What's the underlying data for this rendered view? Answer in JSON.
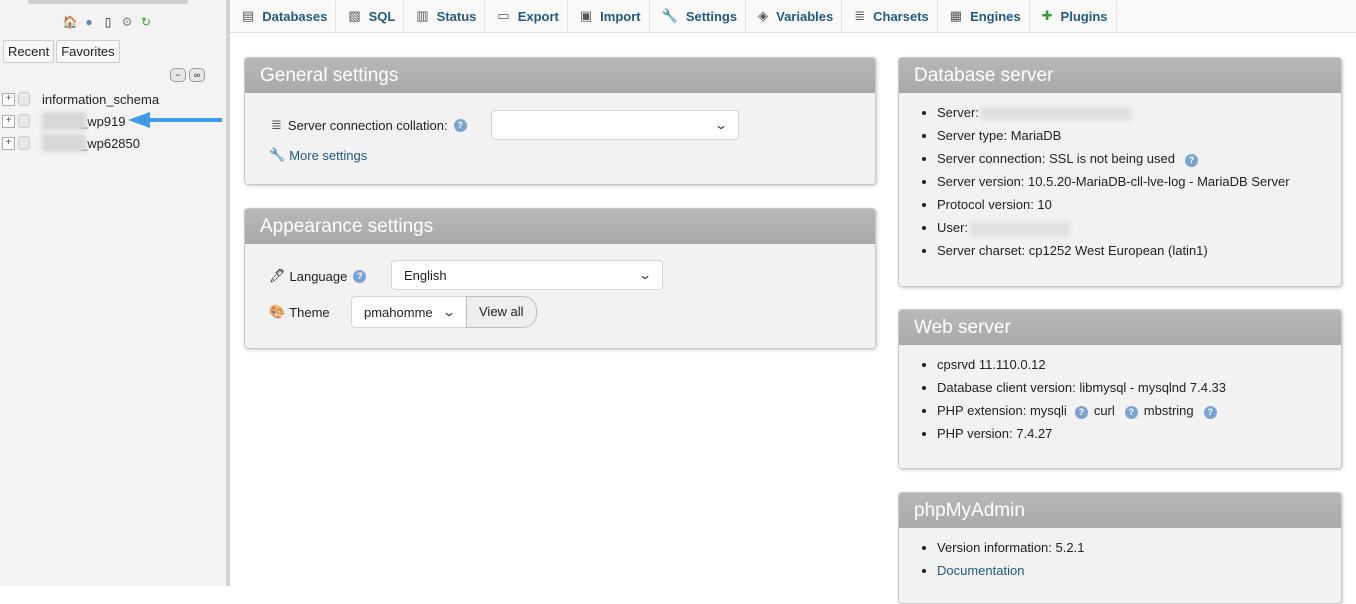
{
  "nav": {
    "tabs": [
      "Recent",
      "Favorites"
    ],
    "databases": [
      {
        "name": "information_schema"
      },
      {
        "name": "_wp919"
      },
      {
        "name": "_wp62850"
      }
    ],
    "icons": [
      "home-icon",
      "help-icon",
      "docs-icon",
      "gear-icon",
      "reload-icon"
    ]
  },
  "topbar": {
    "tabs": [
      {
        "label": "Databases",
        "icon": "database-icon"
      },
      {
        "label": "SQL",
        "icon": "sql-icon"
      },
      {
        "label": "Status",
        "icon": "status-icon"
      },
      {
        "label": "Export",
        "icon": "export-icon"
      },
      {
        "label": "Import",
        "icon": "import-icon"
      },
      {
        "label": "Settings",
        "icon": "wrench-icon"
      },
      {
        "label": "Variables",
        "icon": "variables-icon"
      },
      {
        "label": "Charsets",
        "icon": "charsets-icon"
      },
      {
        "label": "Engines",
        "icon": "engines-icon"
      },
      {
        "label": "Plugins",
        "icon": "plugin-icon"
      }
    ]
  },
  "general": {
    "title": "General settings",
    "collation_label": "Server connection collation:",
    "collation_value": "",
    "more_settings": "More settings"
  },
  "appearance": {
    "title": "Appearance settings",
    "language_label": "Language",
    "language_value": "English",
    "theme_label": "Theme",
    "theme_value": "pmahomme",
    "view_all": "View all"
  },
  "db_server": {
    "title": "Database server",
    "items": [
      "Server:",
      "Server type: MariaDB",
      "Server connection: SSL is not being used",
      "Server version: 10.5.20-MariaDB-cll-lve-log - MariaDB Server",
      "Protocol version: 10",
      "User:",
      "Server charset: cp1252 West European (latin1)"
    ]
  },
  "web_server": {
    "title": "Web server",
    "items": [
      "cpsrvd 11.110.0.12",
      "Database client version: libmysql - mysqlnd 7.4.33",
      "PHP extension: mysqli",
      "curl",
      "mbstring",
      "PHP version: 7.4.27"
    ]
  },
  "pma": {
    "title": "phpMyAdmin",
    "items": [
      "Version information: 5.2.1",
      "Documentation"
    ]
  },
  "colors": {
    "link": "#235a81",
    "arrow": "#3d9be9",
    "panel_header": "#b0b0b0"
  }
}
